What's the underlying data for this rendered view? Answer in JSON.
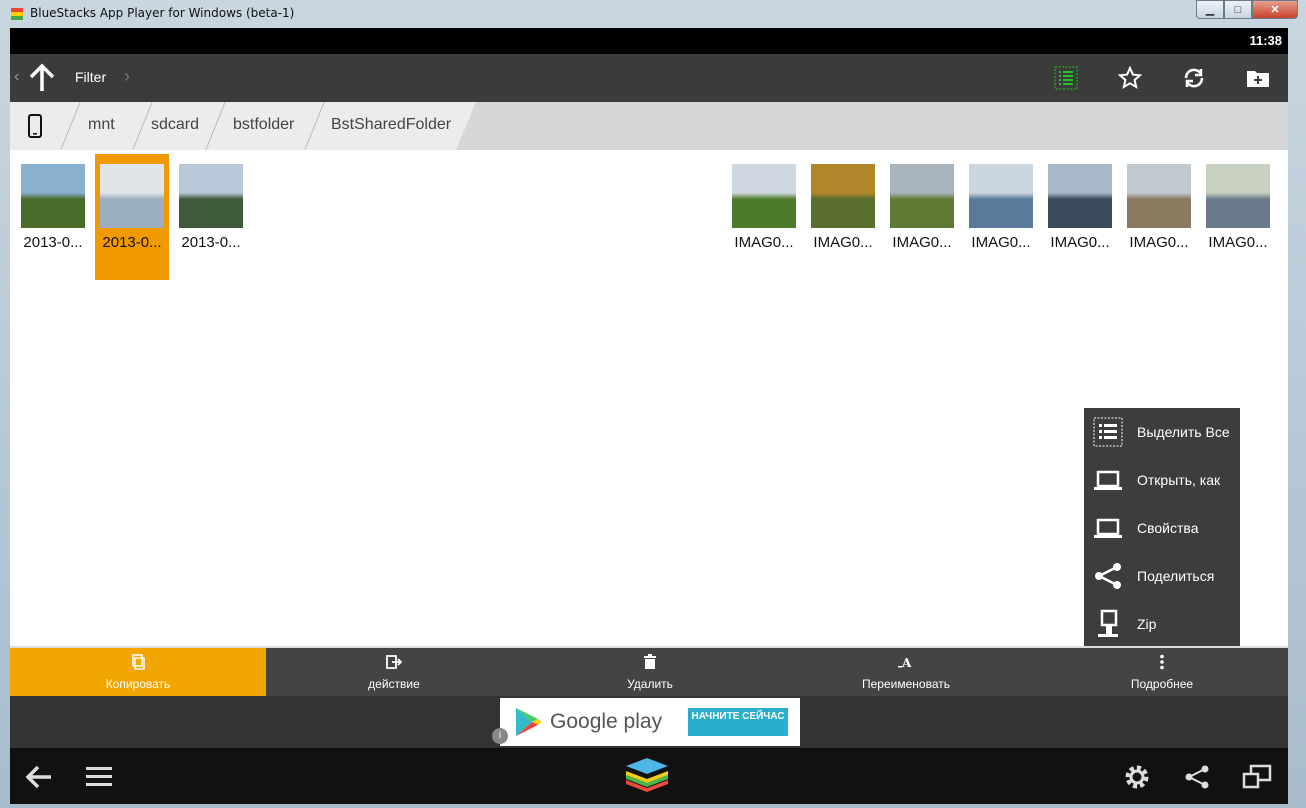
{
  "window": {
    "title": "BlueStacks App Player for Windows (beta-1)"
  },
  "status": {
    "time": "11:38"
  },
  "actionbar": {
    "title": "Filter"
  },
  "breadcrumb": [
    "mnt",
    "sdcard",
    "bstfolder",
    "BstSharedFolder"
  ],
  "files": [
    {
      "label": "2013-0...",
      "selected": false,
      "thumb": [
        "#4a6a2a",
        "#8ab0d0"
      ]
    },
    {
      "label": "2013-0...",
      "selected": true,
      "thumb": [
        "#9ab0c0",
        "#e0e4e8"
      ]
    },
    {
      "label": "2013-0...",
      "selected": false,
      "thumb": [
        "#3e5a3a",
        "#b8c8d8"
      ]
    },
    {
      "label": "IMAG0...",
      "selected": false,
      "thumb": [
        "#4c7a2a",
        "#cfd8e0"
      ]
    },
    {
      "label": "IMAG0...",
      "selected": false,
      "thumb": [
        "#5a6e30",
        "#b0862a"
      ]
    },
    {
      "label": "IMAG0...",
      "selected": false,
      "thumb": [
        "#5e7a34",
        "#a8b4bc"
      ]
    },
    {
      "label": "IMAG0...",
      "selected": false,
      "thumb": [
        "#5a7a9a",
        "#cbd6e0"
      ]
    },
    {
      "label": "IMAG0...",
      "selected": false,
      "thumb": [
        "#3a4a5a",
        "#a8b8c8"
      ]
    },
    {
      "label": "IMAG0...",
      "selected": false,
      "thumb": [
        "#8a7a60",
        "#c0c8d0"
      ]
    },
    {
      "label": "IMAG0...",
      "selected": false,
      "thumb": [
        "#6a7a8a",
        "#c8d0c0"
      ]
    }
  ],
  "popup_menu": [
    {
      "label": "Выделить Все",
      "icon": "select-all-icon"
    },
    {
      "label": "Открыть, как",
      "icon": "laptop-icon"
    },
    {
      "label": "Свойства",
      "icon": "laptop-icon"
    },
    {
      "label": "Поделиться",
      "icon": "share-icon"
    },
    {
      "label": "Zip",
      "icon": "zip-icon"
    }
  ],
  "bottom_actions": [
    {
      "label": "Копировать",
      "icon": "copy-icon",
      "active": true
    },
    {
      "label": "действие",
      "icon": "move-icon",
      "active": false
    },
    {
      "label": "Удалить",
      "icon": "trash-icon",
      "active": false
    },
    {
      "label": "Переименовать",
      "icon": "rename-icon",
      "active": false
    },
    {
      "label": "Подробнее",
      "icon": "more-icon",
      "active": false
    }
  ],
  "ad": {
    "text": "Google play",
    "button": "НАЧНИТЕ СЕЙЧАС"
  },
  "colors": {
    "accent": "#f09a00",
    "actionbar": "#3b3b3b",
    "select_green": "#22c422"
  }
}
